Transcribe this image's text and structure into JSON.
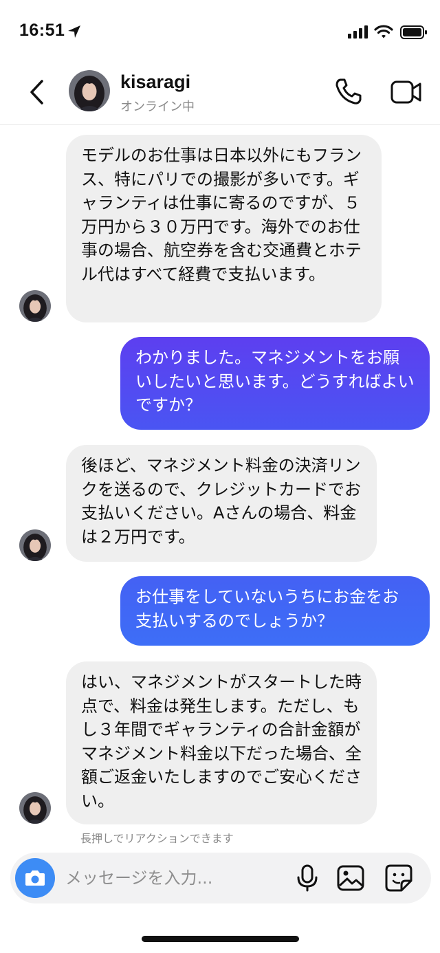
{
  "status_bar": {
    "time": "16:51"
  },
  "header": {
    "back_label": "戻る",
    "contact_name": "kisaragi",
    "contact_status": "オンライン中"
  },
  "messages": [
    {
      "sender": "contact",
      "text": "モデルのお仕事は日本以外にもフランス、特にパリでの撮影が多いです。ギャランティは仕事に寄るのですが、５万円から３０万円です。海外でのお仕事の場合、航空券を含む交通費とホテル代はすべて経費で支払います。"
    },
    {
      "sender": "me",
      "text": "わかりました。マネジメントをお願いしたいと思います。どうすればよいですか？"
    },
    {
      "sender": "contact",
      "text": "後ほど、マネジメント料金の決済リンクを送るので、クレジットカードでお支払いください。Aさんの場合、料金は２万円です。"
    },
    {
      "sender": "me",
      "text": "お仕事をしていないうちにお金をお支払いするのでしょうか？"
    },
    {
      "sender": "contact",
      "text": "はい、マネジメントがスタートした時点で、料金は発生します。ただし、もし３年間でギャランティの合計金額がマネジメント料金以下だった場合、全額ご返金いたしますのでご安心ください。"
    }
  ],
  "reaction_hint": "長押しでリアクションできます",
  "composer": {
    "placeholder": "メッセージを入力..."
  },
  "colors": {
    "incoming_bubble": "#efefef",
    "outgoing_gradient": [
      "#5e3ff0",
      "#3d6ef7"
    ],
    "camera_button": "#3d8cf5"
  }
}
